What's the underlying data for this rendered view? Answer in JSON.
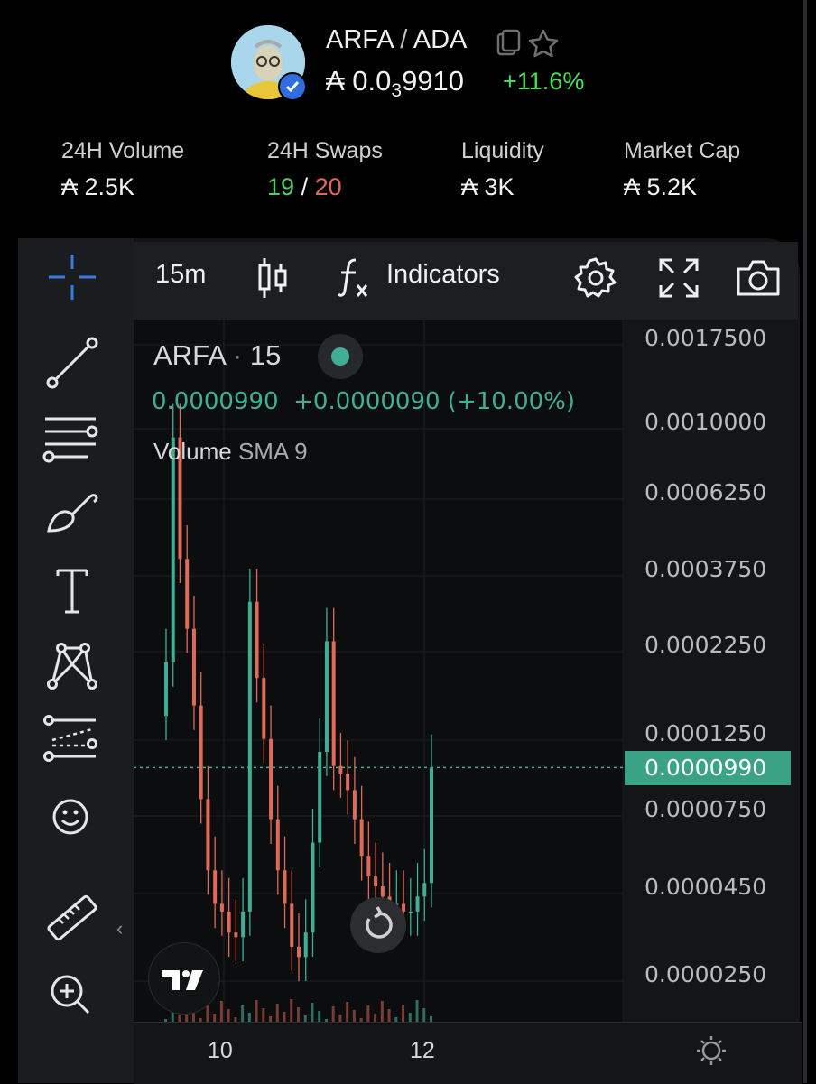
{
  "header": {
    "token": "ARFA",
    "separator": "/",
    "quote": "ADA",
    "price_prefix": "₳ 0.0",
    "price_sub": "3",
    "price_rest": "9910",
    "change": "+11.6%"
  },
  "stats": {
    "volume": {
      "label": "24H Volume",
      "value": "₳ 2.5K"
    },
    "swaps": {
      "label": "24H Swaps",
      "buys": "19",
      "sep": "/",
      "sells": "20"
    },
    "liquidity": {
      "label": "Liquidity",
      "value": "₳ 3K"
    },
    "market_cap": {
      "label": "Market Cap",
      "value": "₳ 5.2K"
    }
  },
  "toolbar": {
    "interval": "15m",
    "indicators_label": "Indicators"
  },
  "legend": {
    "symbol": "ARFA",
    "dot": "·",
    "interval": "15",
    "last": "0.0000990",
    "change": "+0.0000090",
    "change_pct": "(+10.00%)",
    "volume_label": "Volume",
    "sma_label": "SMA 9"
  },
  "price_axis": [
    "0.0017500",
    "0.0010000",
    "0.0006250",
    "0.0003750",
    "0.0002250",
    "0.0001250",
    "0.0000750",
    "0.0000450",
    "0.0000250"
  ],
  "current_price_tag": "0.0000990",
  "time_axis": [
    "10",
    "12"
  ],
  "colors": {
    "up": "#3fae94",
    "down": "#e06a57",
    "accent_green": "#4ade5a",
    "verified": "#2f6de0"
  },
  "chart_data": {
    "type": "candlestick",
    "title": "ARFA · 15",
    "y_scale": "log",
    "ylim": [
      2e-05,
      0.00175
    ],
    "x_ticks": [
      "10",
      "12"
    ],
    "last_price": 9.9e-05,
    "close": [
      0.0002,
      0.0009,
      0.0004,
      0.00025,
      0.00015,
      8e-05,
      5e-05,
      4e-05,
      3.8e-05,
      3.3e-05,
      3.2e-05,
      3.8e-05,
      0.0003,
      0.00018,
      0.00012,
      7e-05,
      5e-05,
      4e-05,
      3e-05,
      2.8e-05,
      3.3e-05,
      6e-05,
      0.00011,
      0.00023,
      0.0001,
      9.5e-05,
      8.5e-05,
      7e-05,
      5.5e-05,
      4.8e-05,
      4.5e-05,
      4.2e-05,
      4e-05,
      4e-05,
      3.8e-05,
      3.8e-05,
      4.2e-05,
      4.6e-05,
      9.9e-05
    ]
  }
}
